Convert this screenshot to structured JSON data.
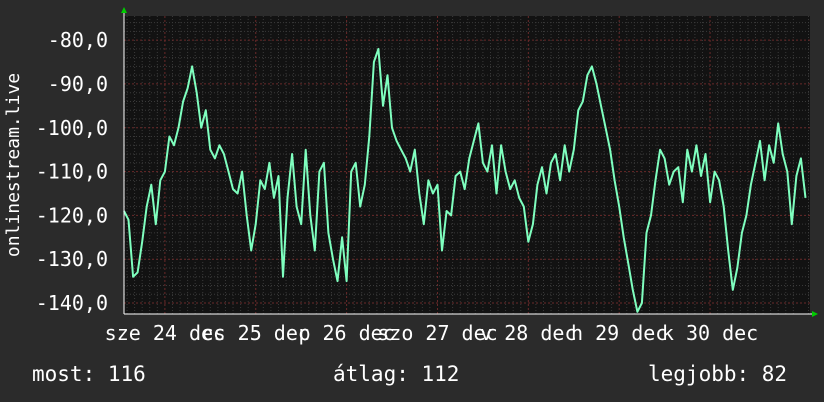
{
  "chart_data": {
    "type": "line",
    "ylabel": "onlinestream.live",
    "ylim": [
      -142.5,
      -74.5
    ],
    "y_ticks": [
      -80,
      -90,
      -100,
      -110,
      -120,
      -130,
      -140
    ],
    "y_tick_labels": [
      "-80,0",
      "-90,0",
      "-100,0",
      "-110,0",
      "-120,0",
      "-130,0",
      "-140,0"
    ],
    "xlim": [
      23.55,
      31.1
    ],
    "x_ticks": [
      24,
      25,
      26,
      27,
      28,
      29,
      30
    ],
    "x_tick_labels": [
      "sze 24 dec",
      "cs 25 dec",
      "p 26 dec",
      "szo 27 dec",
      "v 28 dec",
      "h 29 dec",
      "k 30 dec"
    ],
    "grid": true,
    "colors": {
      "background": "#2b2b2b",
      "plot": "#121212",
      "grid": "#3a3a3a",
      "grid_major": "#6a2a2a",
      "line": "#7fffbf",
      "axis": "#ffffff",
      "arrow": "#00cc00"
    },
    "series": [
      {
        "x": [
          23.55,
          23.6,
          23.65,
          23.7,
          23.75,
          23.8,
          23.85,
          23.9,
          23.95,
          24.0,
          24.05,
          24.1,
          24.15,
          24.2,
          24.25,
          24.3,
          24.35,
          24.4,
          24.45,
          24.5,
          24.55,
          24.6,
          24.65,
          24.7,
          24.75,
          24.8,
          24.85,
          24.9,
          24.95,
          25.0,
          25.05,
          25.1,
          25.15,
          25.2,
          25.25,
          25.3,
          25.35,
          25.4,
          25.45,
          25.5,
          25.55,
          25.6,
          25.65,
          25.7,
          25.75,
          25.8,
          25.85,
          25.9,
          25.95,
          26.0,
          26.05,
          26.1,
          26.15,
          26.2,
          26.25,
          26.3,
          26.35,
          26.4,
          26.45,
          26.5,
          26.55,
          26.6,
          26.65,
          26.7,
          26.75,
          26.8,
          26.85,
          26.9,
          26.95,
          27.0,
          27.05,
          27.1,
          27.15,
          27.2,
          27.25,
          27.3,
          27.35,
          27.4,
          27.45,
          27.5,
          27.55,
          27.6,
          27.65,
          27.7,
          27.75,
          27.8,
          27.85,
          27.9,
          27.95,
          28.0,
          28.05,
          28.1,
          28.15,
          28.2,
          28.25,
          28.3,
          28.35,
          28.4,
          28.45,
          28.5,
          28.55,
          28.6,
          28.65,
          28.7,
          28.75,
          28.8,
          28.85,
          28.9,
          28.95,
          29.0,
          29.05,
          29.1,
          29.15,
          29.2,
          29.25,
          29.3,
          29.35,
          29.4,
          29.45,
          29.5,
          29.55,
          29.6,
          29.65,
          29.7,
          29.75,
          29.8,
          29.85,
          29.9,
          29.95,
          30.0,
          30.05,
          30.1,
          30.15,
          30.2,
          30.25,
          30.3,
          30.35,
          30.4,
          30.45,
          30.5,
          30.55,
          30.6,
          30.65,
          30.7,
          30.75,
          30.8,
          30.85,
          30.9,
          30.95,
          31.0,
          31.05
        ],
        "y": [
          -119,
          -121,
          -134,
          -133,
          -126,
          -118,
          -113,
          -122,
          -112,
          -110,
          -102,
          -104,
          -100,
          -94,
          -91,
          -86,
          -92,
          -100,
          -96,
          -105,
          -107,
          -104,
          -106,
          -110,
          -114,
          -115,
          -110,
          -120,
          -128,
          -122,
          -112,
          -114,
          -108,
          -116,
          -111,
          -134,
          -116,
          -106,
          -118,
          -122,
          -105,
          -120,
          -128,
          -110,
          -108,
          -124,
          -130,
          -135,
          -125,
          -135,
          -110,
          -108,
          -118,
          -113,
          -102,
          -85,
          -82,
          -95,
          -88,
          -100,
          -103,
          -105,
          -107,
          -110,
          -105,
          -115,
          -122,
          -112,
          -115,
          -113,
          -128,
          -119,
          -120,
          -111,
          -110,
          -114,
          -107,
          -103,
          -99,
          -108,
          -110,
          -104,
          -115,
          -104,
          -110,
          -114,
          -112,
          -116,
          -118,
          -126,
          -122,
          -113,
          -109,
          -115,
          -108,
          -106,
          -112,
          -104,
          -110,
          -105,
          -96,
          -94,
          -88,
          -86,
          -90,
          -95,
          -100,
          -105,
          -112,
          -118,
          -125,
          -131,
          -137,
          -142,
          -140,
          -124,
          -120,
          -112,
          -105,
          -107,
          -113,
          -110,
          -109,
          -117,
          -105,
          -110,
          -104,
          -111,
          -106,
          -117,
          -110,
          -112,
          -118,
          -128,
          -137,
          -132,
          -124,
          -120,
          -113,
          -108,
          -103,
          -112,
          -104,
          -108,
          -99,
          -106,
          -110,
          -122,
          -111,
          -107,
          -116
        ]
      }
    ]
  },
  "stats": {
    "now": "most: 116",
    "avg": "átlag: 112",
    "best": "legjobb: 82"
  }
}
